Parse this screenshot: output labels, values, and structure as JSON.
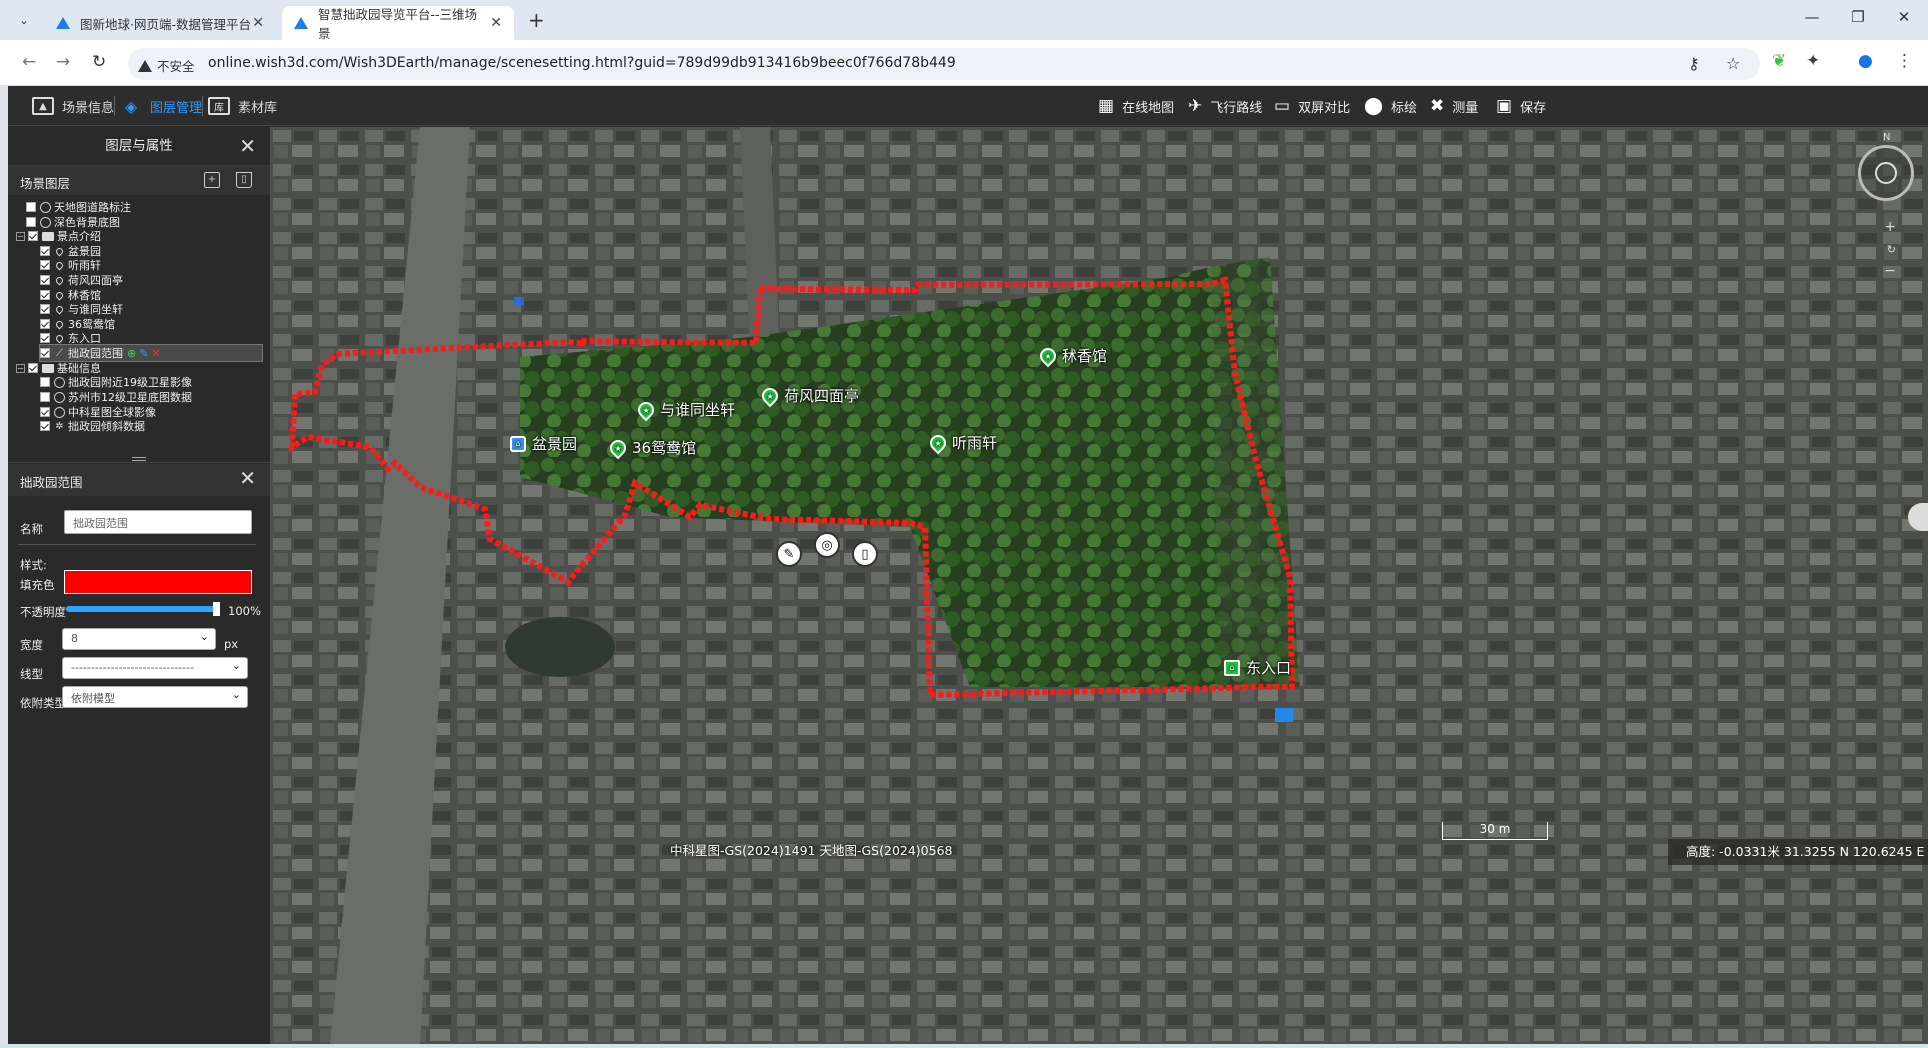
{
  "browser": {
    "tabs": [
      {
        "title": "图新地球·网页端-数据管理平台",
        "close": "✕"
      },
      {
        "title": "智慧拙政园导览平台--三维场景",
        "close": "✕"
      }
    ],
    "new_tab": "+",
    "window_controls": {
      "minimize": "—",
      "restore": "❐",
      "close": "✕"
    },
    "security_label": "不安全",
    "url": "online.wish3d.com/Wish3DEarth/manage/scenesetting.html?guid=789d99db913416b9beec0f766d78b449"
  },
  "app": {
    "menu": [
      {
        "label": "场景信息",
        "icon": "image-icon"
      },
      {
        "label": "图层管理",
        "icon": "layers-icon"
      },
      {
        "label": "素材库",
        "icon": "library-icon",
        "icon_text": "库"
      }
    ],
    "tools": [
      {
        "label": "在线地图",
        "icon": "online-map-icon",
        "glyph": "▦"
      },
      {
        "label": "飞行路线",
        "icon": "flight-route-icon",
        "glyph": "✈"
      },
      {
        "label": "双屏对比",
        "icon": "dual-screen-icon",
        "glyph": "▭"
      },
      {
        "label": "标绘",
        "icon": "plot-pin-icon",
        "glyph": "⬤"
      },
      {
        "label": "测量",
        "icon": "measure-icon",
        "glyph": "✖"
      },
      {
        "label": "保存",
        "icon": "save-icon",
        "glyph": "▣"
      }
    ],
    "accent": "#2f9bff"
  },
  "panel": {
    "title": "图层与属性",
    "scene_layers_title": "场景图层",
    "tree": [
      {
        "label": "天地图道路标注",
        "level": 1,
        "checked": false,
        "icon": "globe-icon"
      },
      {
        "label": "深色背景底图",
        "level": 1,
        "checked": false,
        "icon": "globe-icon"
      },
      {
        "label": "景点介绍",
        "level": 0,
        "checked": true,
        "icon": "folder-icon",
        "expand": "−"
      },
      {
        "label": "盆景园",
        "level": 2,
        "checked": true,
        "icon": "pin-icon"
      },
      {
        "label": "听雨轩",
        "level": 2,
        "checked": true,
        "icon": "pin-icon"
      },
      {
        "label": "荷风四面亭",
        "level": 2,
        "checked": true,
        "icon": "pin-icon"
      },
      {
        "label": "秫香馆",
        "level": 2,
        "checked": true,
        "icon": "pin-icon"
      },
      {
        "label": "与谁同坐轩",
        "level": 2,
        "checked": true,
        "icon": "pin-icon"
      },
      {
        "label": "36鸳鸯馆",
        "level": 2,
        "checked": true,
        "icon": "pin-icon"
      },
      {
        "label": "东入口",
        "level": 2,
        "checked": true,
        "icon": "pin-icon"
      },
      {
        "label": "拙政园范围",
        "level": 2,
        "checked": true,
        "icon": "polyline-icon",
        "selected": true
      },
      {
        "label": "基础信息",
        "level": 0,
        "checked": true,
        "icon": "folder-icon",
        "expand": "−"
      },
      {
        "label": "拙政园附近19级卫星影像",
        "level": 2,
        "checked": false,
        "icon": "globe-icon"
      },
      {
        "label": "苏州市12级卫星底图数据",
        "level": 2,
        "checked": false,
        "icon": "globe-icon"
      },
      {
        "label": "中科星图全球影像",
        "level": 2,
        "checked": true,
        "icon": "globe-icon"
      },
      {
        "label": "拙政园倾斜数据",
        "level": 2,
        "checked": true,
        "icon": "oblique-model-icon"
      }
    ],
    "props": {
      "title": "拙政园范围",
      "name_label": "名称",
      "name_value": "拙政园范围",
      "style_label": "样式:",
      "fill_label": "填充色",
      "fill_color": "#ff0000",
      "opacity_label": "不透明度",
      "opacity_value": "100%",
      "opacity": 1.0,
      "width_label": "宽度",
      "width_value": "8",
      "width_unit": "px",
      "linetype_label": "线型",
      "linetype_value": "-------------------------------",
      "attach_label": "依附类型",
      "attach_value": "依附模型"
    }
  },
  "map": {
    "pois": [
      {
        "label": "秫香馆",
        "kind": "star"
      },
      {
        "label": "荷风四面亭",
        "kind": "star"
      },
      {
        "label": "与谁同坐轩",
        "kind": "star"
      },
      {
        "label": "听雨轩",
        "kind": "star"
      },
      {
        "label": "36鸳鸯馆",
        "kind": "star"
      },
      {
        "label": "盆景园",
        "kind": "building"
      },
      {
        "label": "东入口",
        "kind": "home"
      }
    ],
    "boundary_color": "#ff1a1a",
    "compass_north": "N",
    "zoom": {
      "plus": "+",
      "reset": "↻",
      "minus": "−"
    },
    "copyright": "中科星图-GS(2024)1491 天地图-GS(2024)0568",
    "scale": "30 m",
    "status": "高度: -0.0331米 31.3255 N 120.6245 E"
  }
}
